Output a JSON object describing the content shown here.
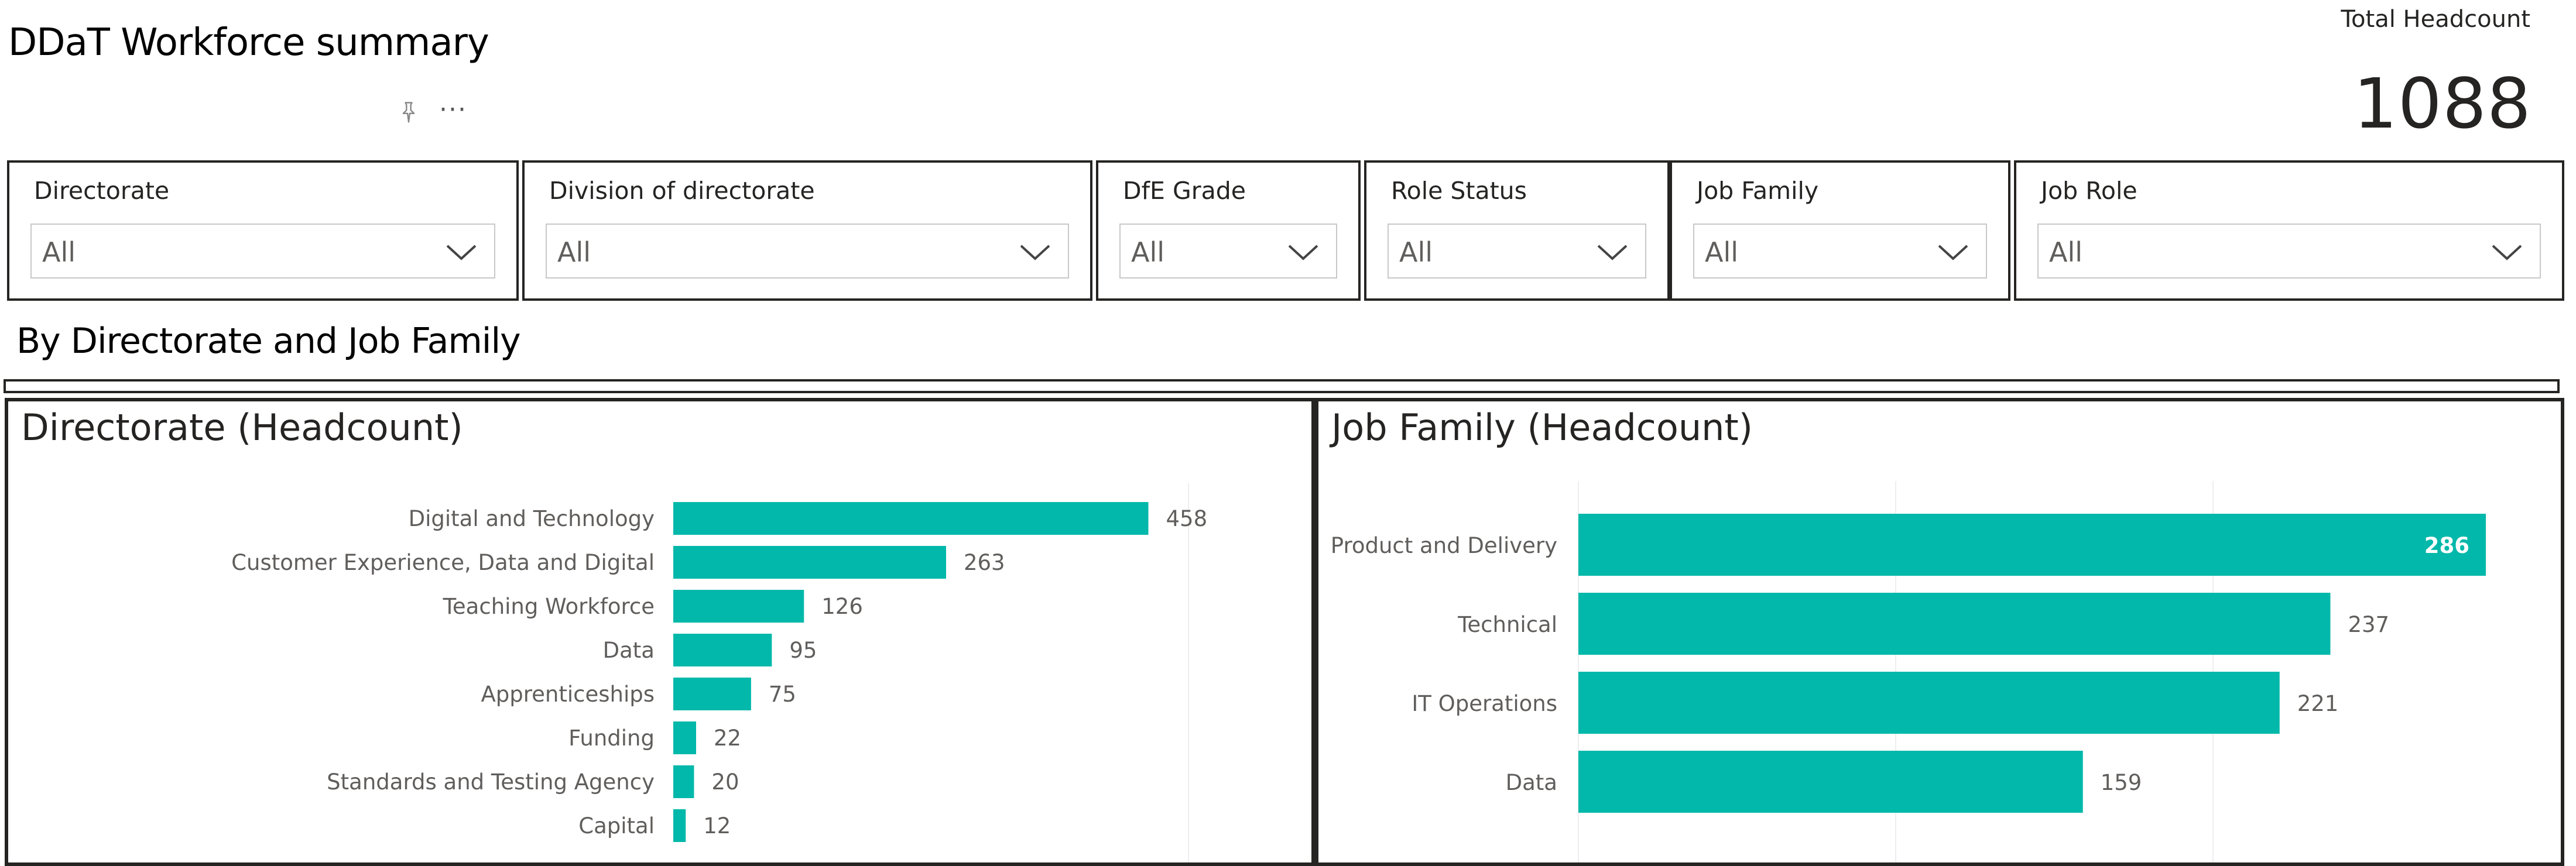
{
  "header": {
    "title": "DDaT Workforce summary",
    "kpi_label": "Total Headcount",
    "kpi_value": "1088"
  },
  "visual_header": {
    "pin_icon": "pin-icon",
    "more_icon": "more-options-icon",
    "more_glyph": "···"
  },
  "slicers": [
    {
      "label": "Directorate",
      "value": "All"
    },
    {
      "label": "Division of directorate",
      "value": "All"
    },
    {
      "label": "DfE Grade",
      "value": "All"
    },
    {
      "label": "Role Status",
      "value": "All"
    },
    {
      "label": "Job Family",
      "value": "All"
    },
    {
      "label": "Job Role",
      "value": "All"
    }
  ],
  "section": {
    "title": "By Directorate and Job Family"
  },
  "colors": {
    "bar": "#01B8AA",
    "grid": "#eeeeee",
    "label": "#605e5c"
  },
  "chart_data": [
    {
      "type": "bar",
      "title": "Directorate (Headcount)",
      "orientation": "horizontal",
      "categories": [
        "Digital and Technology",
        "Customer Experience, Data and Digital",
        "Teaching Workforce",
        "Data",
        "Apprenticeships",
        "Funding",
        "Standards and Testing Agency",
        "Capital"
      ],
      "values": [
        458,
        263,
        126,
        95,
        75,
        22,
        20,
        12
      ],
      "data_labels": true,
      "xlim": [
        0,
        500
      ]
    },
    {
      "type": "bar",
      "title": "Job Family (Headcount)",
      "orientation": "horizontal",
      "categories": [
        "Product and Delivery",
        "Technical",
        "IT Operations",
        "Data"
      ],
      "values": [
        286,
        237,
        221,
        159
      ],
      "data_labels": true,
      "xlim": [
        0,
        300
      ],
      "grid": true
    }
  ]
}
